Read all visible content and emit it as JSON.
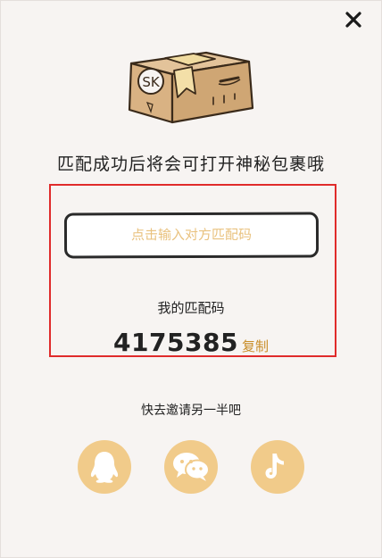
{
  "dialog": {
    "headline": "匹配成功后将会可打开神秘包裹哦",
    "box_label": "SK"
  },
  "match": {
    "input_placeholder": "点击输入对方匹配码",
    "my_code_label": "我的匹配码",
    "my_code": "4175385",
    "copy_label": "复制"
  },
  "invite": {
    "text": "快去邀请另一半吧",
    "channels": [
      {
        "name": "qq",
        "icon": "qq-penguin-icon"
      },
      {
        "name": "wechat",
        "icon": "wechat-chat-bubbles-icon"
      },
      {
        "name": "douyin",
        "icon": "douyin-note-icon"
      }
    ]
  },
  "colors": {
    "accent": "#f1cb8a",
    "copy_text": "#c98e2a",
    "placeholder": "#e9c27f",
    "highlight_frame": "#e02b2b",
    "panel_bg": "#f7f4f2"
  }
}
